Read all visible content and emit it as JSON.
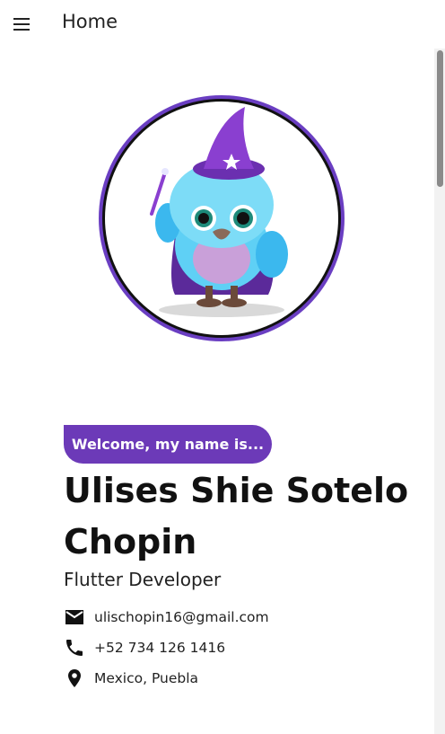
{
  "appbar": {
    "title": "Home",
    "menu_icon": "hamburger-menu-icon"
  },
  "profile": {
    "badge": "Welcome, my name is...",
    "name": "Ulises Shie Sotelo Chopin",
    "role": "Flutter Developer",
    "avatar": "wizard-owl-illustration"
  },
  "contacts": [
    {
      "icon": "email-icon",
      "text": "ulischopin16@gmail.com"
    },
    {
      "icon": "phone-icon",
      "text": "+52 734 126 1416"
    },
    {
      "icon": "location-pin-icon",
      "text": "Mexico, Puebla"
    }
  ],
  "colors": {
    "accent": "#6c3ab8",
    "ring": "#6a3ec2",
    "text": "#111111"
  }
}
